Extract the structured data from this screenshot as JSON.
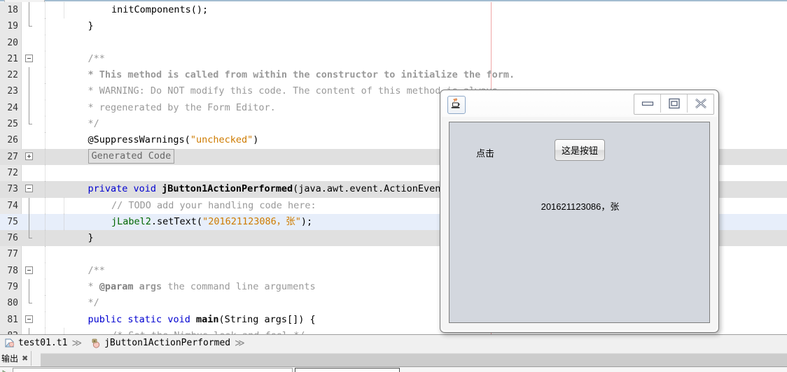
{
  "editor": {
    "breadcrumb": {
      "items": [
        {
          "icon": "file-icon",
          "label": "test01.t1"
        },
        {
          "icon": "method-icon",
          "label": "jButton1ActionPerformed"
        }
      ],
      "separator": "≫"
    },
    "generated_code_label": "Generated Code",
    "lines": [
      {
        "no": "18",
        "indent": 3,
        "tokens": [
          {
            "t": "initComponents",
            "c": "plain"
          },
          {
            "t": "();",
            "c": "plain"
          }
        ]
      },
      {
        "no": "19",
        "indent": 2,
        "tokens": [
          {
            "t": "}",
            "c": "plain"
          }
        ]
      },
      {
        "no": "20",
        "indent": 0,
        "tokens": []
      },
      {
        "no": "21",
        "indent": 2,
        "tokens": [
          {
            "t": "/**",
            "c": "cmt"
          }
        ]
      },
      {
        "no": "22",
        "indent": 2,
        "tokens": [
          {
            "t": " * This method is called from within the constructor to initialize the form.",
            "c": "cmtb"
          }
        ]
      },
      {
        "no": "23",
        "indent": 2,
        "tokens": [
          {
            "t": " * WARNING: Do NOT modify this code. The content of this method is ",
            "c": "cmt"
          },
          {
            "t": "always",
            "c": "cmt-under"
          }
        ]
      },
      {
        "no": "24",
        "indent": 2,
        "tokens": [
          {
            "t": " * regenerated by the Form Editor.",
            "c": "cmt"
          }
        ]
      },
      {
        "no": "25",
        "indent": 2,
        "tokens": [
          {
            "t": " */",
            "c": "cmt"
          }
        ]
      },
      {
        "no": "26",
        "indent": 2,
        "tokens": [
          {
            "t": "@SuppressWarnings",
            "c": "plain"
          },
          {
            "t": "(",
            "c": "plain"
          },
          {
            "t": "\"unchecked\"",
            "c": "str"
          },
          {
            "t": ")",
            "c": "plain"
          }
        ]
      },
      {
        "no": "27",
        "indent": 2,
        "tokens": []
      },
      {
        "no": "72",
        "indent": 0,
        "tokens": []
      },
      {
        "no": "73",
        "indent": 2,
        "tokens": [
          {
            "t": "private ",
            "c": "kw"
          },
          {
            "t": "void ",
            "c": "kw"
          },
          {
            "t": "jButton1ActionPerformed",
            "c": "mth"
          },
          {
            "t": "(java.awt.event.ActionEvent",
            "c": "plain"
          }
        ]
      },
      {
        "no": "74",
        "indent": 3,
        "tokens": [
          {
            "t": "// TODO add your handling code here:",
            "c": "cmt"
          }
        ]
      },
      {
        "no": "75",
        "indent": 3,
        "tokens": [
          {
            "t": "jLabel2",
            "c": "fld"
          },
          {
            "t": ".setText(",
            "c": "plain"
          },
          {
            "t": "\"201621123086，张\"",
            "c": "str"
          },
          {
            "t": ");",
            "c": "plain"
          }
        ]
      },
      {
        "no": "76",
        "indent": 2,
        "tokens": [
          {
            "t": "}",
            "c": "plain"
          }
        ]
      },
      {
        "no": "77",
        "indent": 0,
        "tokens": []
      },
      {
        "no": "78",
        "indent": 2,
        "tokens": [
          {
            "t": "/**",
            "c": "cmt"
          }
        ]
      },
      {
        "no": "79",
        "indent": 2,
        "tokens": [
          {
            "t": " * ",
            "c": "cmt"
          },
          {
            "t": "@param",
            "c": "annk"
          },
          {
            "t": " args",
            "c": "cmtb"
          },
          {
            "t": " the command line arguments",
            "c": "cmt"
          }
        ]
      },
      {
        "no": "80",
        "indent": 2,
        "tokens": [
          {
            "t": " */",
            "c": "cmt"
          }
        ]
      },
      {
        "no": "81",
        "indent": 2,
        "tokens": [
          {
            "t": "public ",
            "c": "kw"
          },
          {
            "t": "static ",
            "c": "kw"
          },
          {
            "t": "void ",
            "c": "kw"
          },
          {
            "t": "main",
            "c": "mth"
          },
          {
            "t": "(String args[]) {",
            "c": "plain"
          }
        ]
      },
      {
        "no": "82",
        "indent": 3,
        "tokens": [
          {
            "t": "/* Set the Nimbus look and feel */",
            "c": "cmt"
          }
        ]
      }
    ]
  },
  "output": {
    "tab_label": "输出",
    "close_glyph": "✖"
  },
  "java_window": {
    "title": "",
    "icon": "java-cup-icon",
    "buttons": {
      "minimize": "minimize-icon",
      "maximize": "maximize-icon",
      "close": "close-icon"
    },
    "content": {
      "label_click": "点击",
      "button_label": "这是按钮",
      "result_label": "201621123086，张"
    }
  },
  "colors": {
    "keyword": "#0000d0",
    "comment": "#999999",
    "string": "#ce7b00",
    "field": "#006600",
    "caret_row": "#e7eefa",
    "guarded_row": "#e0e0e0",
    "margin_line": "#f0a7a7",
    "panel_bg": "#d3d7de"
  }
}
